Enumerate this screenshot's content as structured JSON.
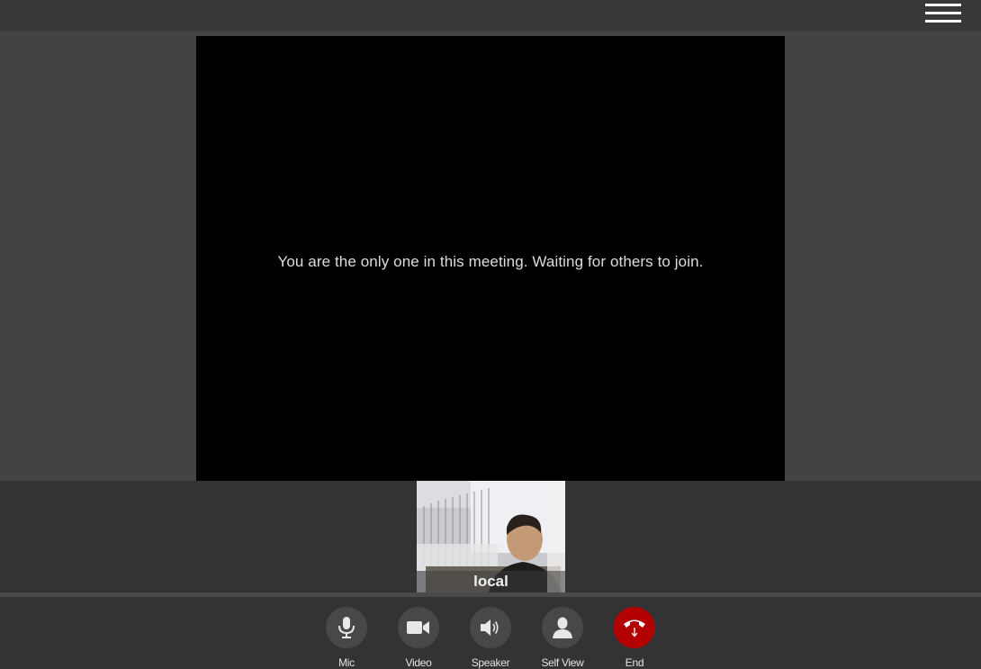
{
  "header": {
    "menu_icon": "hamburger-menu-icon"
  },
  "stage": {
    "waiting_message": "You are the only one in this meeting. Waiting for others to join."
  },
  "self_view": {
    "label": "local"
  },
  "controls": [
    {
      "id": "mic",
      "label": "Mic",
      "icon": "microphone-icon"
    },
    {
      "id": "video",
      "label": "Video",
      "icon": "video-camera-icon"
    },
    {
      "id": "speaker",
      "label": "Speaker",
      "icon": "speaker-icon"
    },
    {
      "id": "self_view",
      "label": "Self View",
      "icon": "person-icon"
    },
    {
      "id": "end",
      "label": "End",
      "icon": "hang-up-phone-icon",
      "color": "#b30000"
    }
  ]
}
